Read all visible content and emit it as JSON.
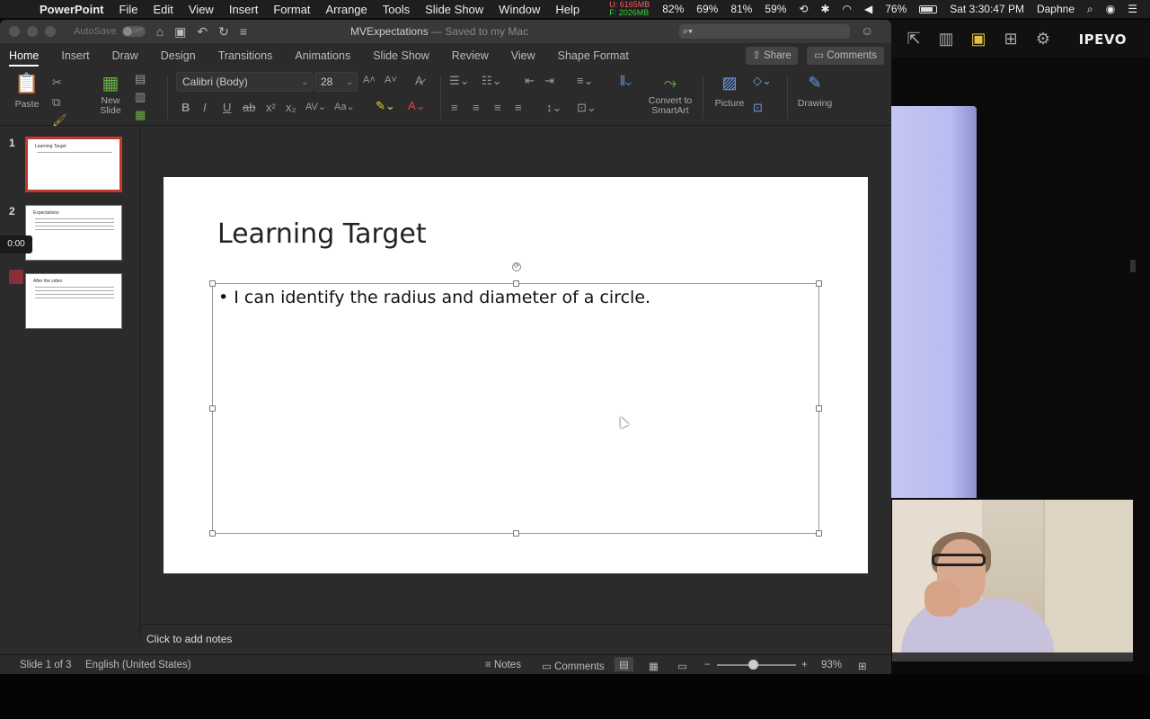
{
  "menubar": {
    "app_name": "PowerPoint",
    "menus": [
      "File",
      "Edit",
      "View",
      "Insert",
      "Format",
      "Arrange",
      "Tools",
      "Slide Show",
      "Window",
      "Help"
    ],
    "mem_u": "U: 6165MB",
    "mem_f": "F: 2026MB",
    "stats": [
      "82%",
      "69%",
      "81%",
      "59%"
    ],
    "battery": "76%",
    "clock": "Sat 3:30:47 PM",
    "user": "Daphne"
  },
  "titlebar": {
    "autosave": "AutoSave",
    "autosave_state": "OFF",
    "doc_name": "MVExpectations",
    "saved_status": "— Saved to my Mac"
  },
  "ribbon": {
    "tabs": [
      "Home",
      "Insert",
      "Draw",
      "Design",
      "Transitions",
      "Animations",
      "Slide Show",
      "Review",
      "View",
      "Shape Format"
    ],
    "active_tab": "Home",
    "share": "Share",
    "comments": "Comments",
    "paste": "Paste",
    "new_slide": "New\nSlide",
    "font_name": "Calibri (Body)",
    "font_size": "28",
    "convert_smartart": "Convert to\nSmartArt",
    "picture": "Picture",
    "drawing": "Drawing"
  },
  "slides": {
    "thumbnails": [
      {
        "num": "1",
        "title": "Learning Target"
      },
      {
        "num": "2",
        "title": "Expectations"
      },
      {
        "num": "3",
        "title": "After the video"
      }
    ],
    "timer": "0:00"
  },
  "current_slide": {
    "title": "Learning Target",
    "bullet": "I can identify the radius and diameter of a circle."
  },
  "notes_placeholder": "Click to add notes",
  "statusbar": {
    "slide_info": "Slide 1 of 3",
    "language": "English (United States)",
    "notes": "Notes",
    "comments": "Comments",
    "zoom": "93%"
  },
  "ipevo": {
    "logo": "IPEVO"
  }
}
